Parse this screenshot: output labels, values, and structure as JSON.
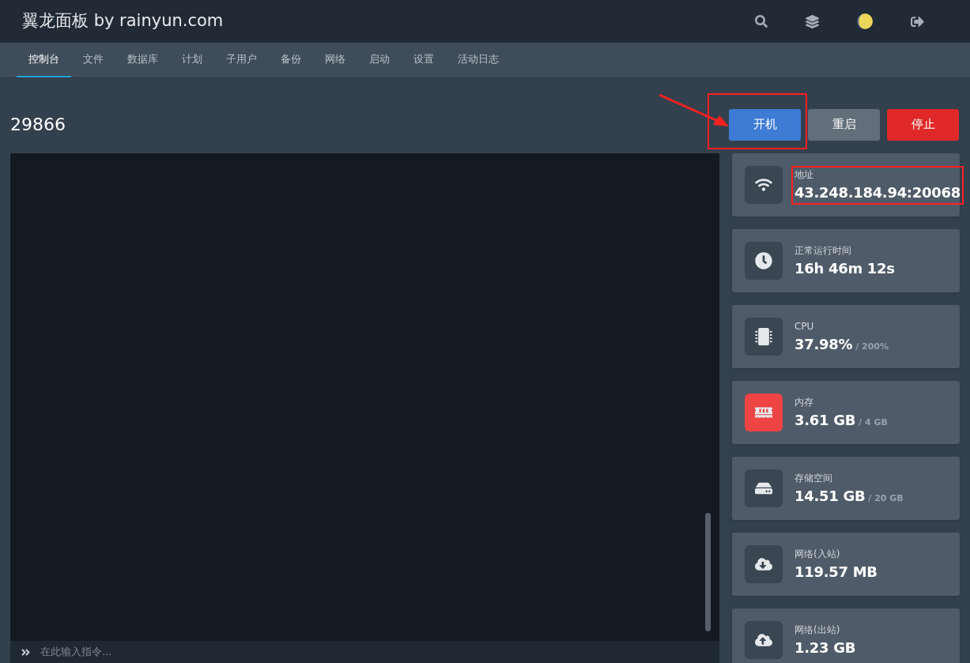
{
  "header": {
    "title": "翼龙面板 by rainyun.com"
  },
  "nav": [
    {
      "label": "控制台",
      "selected": true
    },
    {
      "label": "文件",
      "selected": false
    },
    {
      "label": "数据库",
      "selected": false
    },
    {
      "label": "计划",
      "selected": false
    },
    {
      "label": "子用户",
      "selected": false
    },
    {
      "label": "备份",
      "selected": false
    },
    {
      "label": "网络",
      "selected": false
    },
    {
      "label": "启动",
      "selected": false
    },
    {
      "label": "设置",
      "selected": false
    },
    {
      "label": "活动日志",
      "selected": false
    }
  ],
  "server": {
    "name": "29866"
  },
  "power_buttons": [
    {
      "label": "开机",
      "kind": "start",
      "highlighted": true
    },
    {
      "label": "重启",
      "kind": "restart",
      "highlighted": false
    },
    {
      "label": "停止",
      "kind": "stop",
      "highlighted": false
    }
  ],
  "console": {
    "placeholder": "在此输入指令..."
  },
  "stats": [
    {
      "kind": "wifi",
      "label": "地址",
      "value": "43.248.184.94:20068",
      "alert": false,
      "highlighted": true
    },
    {
      "kind": "clock",
      "label": "正常运行时间",
      "value": "16h 46m 12s",
      "alert": false,
      "highlighted": false
    },
    {
      "kind": "cpu",
      "label": "CPU",
      "value": "37.98%",
      "limit": "/ 200%",
      "alert": false,
      "highlighted": false
    },
    {
      "kind": "memory",
      "label": "内存",
      "value": "3.61 GB",
      "limit": "/ 4 GB",
      "alert": true,
      "highlighted": false
    },
    {
      "kind": "disk",
      "label": "存储空间",
      "value": "14.51 GB",
      "limit": "/ 20 GB",
      "alert": false,
      "highlighted": false
    },
    {
      "kind": "download",
      "label": "网络(入站)",
      "value": "119.57 MB",
      "alert": false,
      "highlighted": false
    },
    {
      "kind": "upload",
      "label": "网络(出站)",
      "value": "1.23 GB",
      "alert": false,
      "highlighted": false
    }
  ]
}
